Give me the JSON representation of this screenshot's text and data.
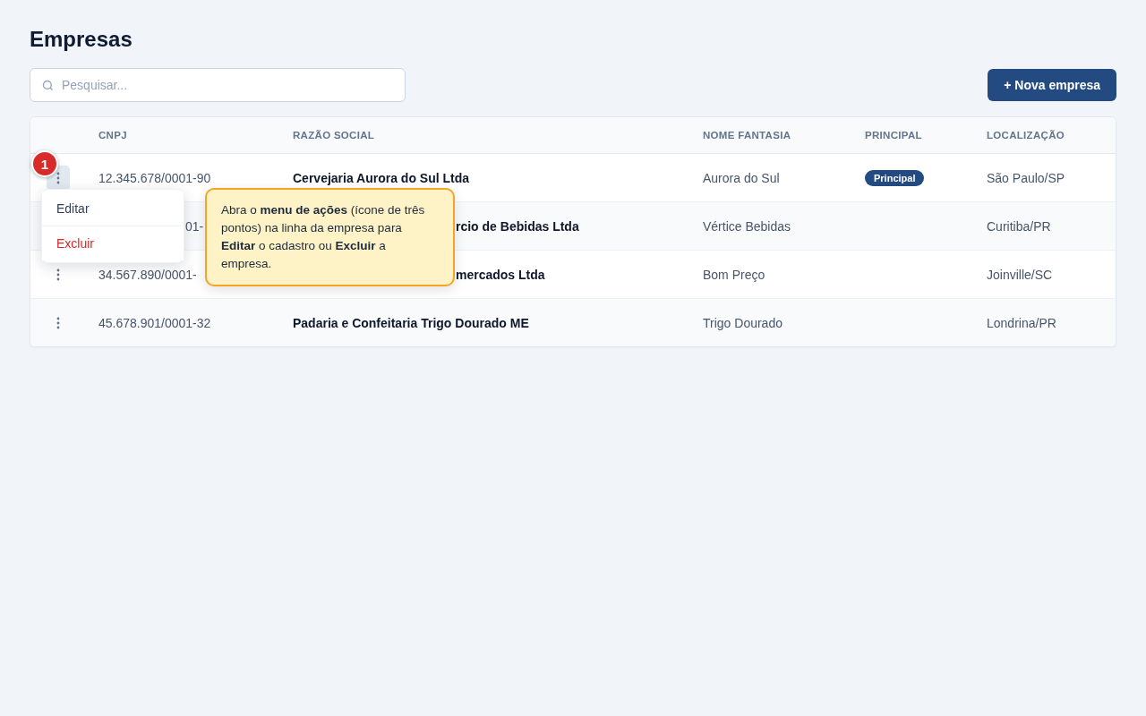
{
  "title": "Empresas",
  "search": {
    "placeholder": "Pesquisar..."
  },
  "new_button": "+ Nova empresa",
  "table": {
    "columns": [
      "CNPJ",
      "RAZÃO SOCIAL",
      "NOME FANTASIA",
      "PRINCIPAL",
      "LOCALIZAÇÃO"
    ],
    "rows": [
      {
        "menu_active": true,
        "cnpj": "12.345.678/0001-90",
        "razao": "Cervejaria Aurora do Sul Ltda",
        "fantasia": "Aurora do Sul",
        "principal": "Principal",
        "local": "São Paulo/SP"
      },
      {
        "cnpj": "01-",
        "razao": "rcio de Bebidas Ltda",
        "fantasia": "Vértice Bebidas",
        "local": "Curitiba/PR"
      },
      {
        "menu_active": false,
        "cnpj": "34.567.890/0001-",
        "razao": "mercados Ltda",
        "fantasia": "Bom Preço",
        "local": "Joinville/SC"
      },
      {
        "menu_active": false,
        "cnpj": "45.678.901/0001-32",
        "razao": "Padaria e Confeitaria Trigo Dourado ME",
        "fantasia": "Trigo Dourado",
        "local": "Londrina/PR"
      }
    ]
  },
  "step_badge": "1",
  "action_menu": [
    {
      "label": "Editar",
      "kind": "normal"
    },
    {
      "label": "Excluir",
      "kind": "danger"
    }
  ],
  "tooltip": "Abra o **menu de ações** (ícone de três pontos) na linha da empresa para **Editar** o cadastro ou **Excluir** a empresa."
}
